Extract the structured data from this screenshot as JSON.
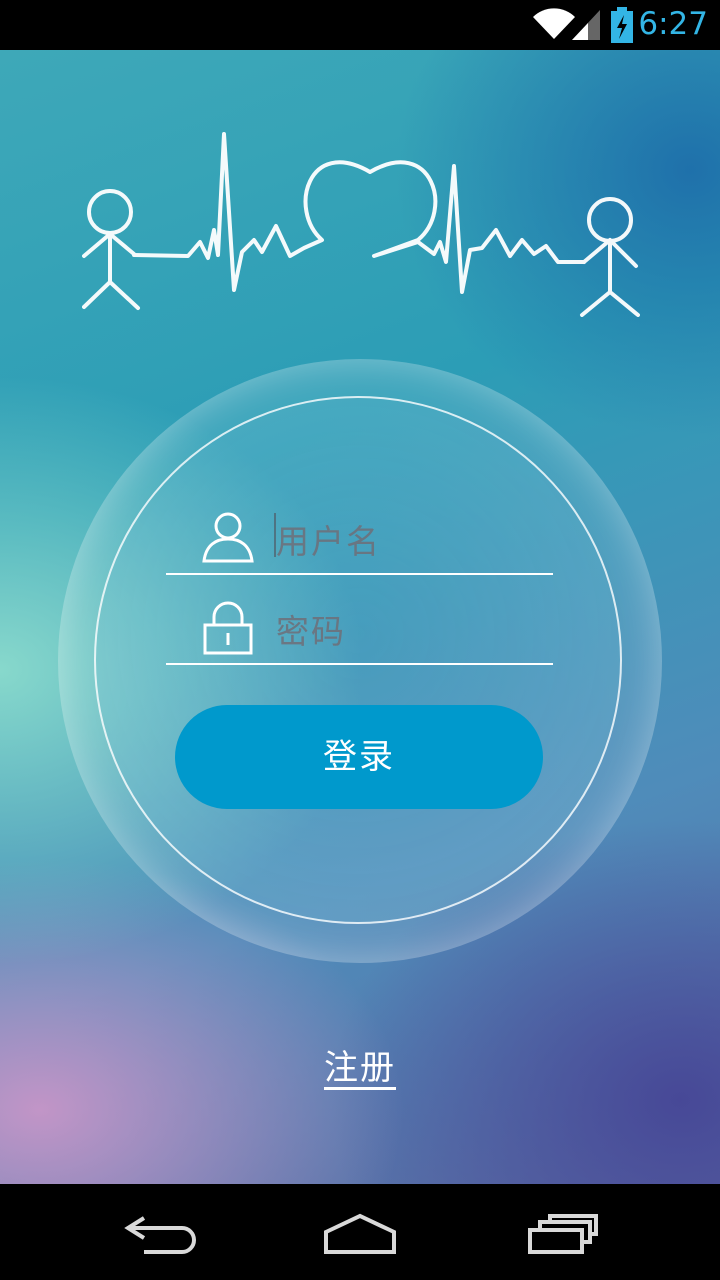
{
  "status_bar": {
    "time": "6:27",
    "icons": [
      "wifi-icon",
      "signal-icon",
      "battery-charging-icon"
    ],
    "accent_color": "#33b5e5"
  },
  "login": {
    "logo": "heartbeat-people-logo",
    "username_placeholder": "用户名",
    "password_placeholder": "密码",
    "login_label": "登录",
    "register_label": "注册",
    "button_color": "#0099cc"
  },
  "nav_bar": {
    "buttons": [
      "back-icon",
      "home-icon",
      "recent-apps-icon"
    ]
  }
}
